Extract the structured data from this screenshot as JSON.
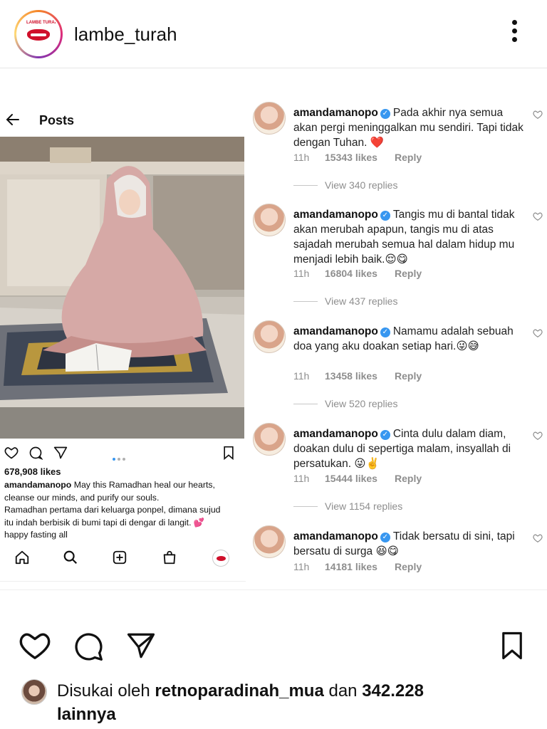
{
  "header": {
    "account": "lambe_turah",
    "logo_text": "LAMBE TURAH"
  },
  "inner_post": {
    "title": "Posts",
    "likes": "678,908 likes",
    "caption_user": "amandamanopo",
    "caption_lines": [
      " May this Ramadhan heal our hearts,",
      "cleanse our minds, and purify our souls.",
      "Ramadhan pertama dari keluarga ponpel, dimana sujud",
      "itu indah berbisik di bumi tapi di dengar di langit. 💕",
      "happy fasting all"
    ]
  },
  "comments": [
    {
      "user": "amandamanopo",
      "text": "Pada akhir nya semua akan pergi meninggalkan mu sendiri. Tapi tidak dengan Tuhan. ❤️",
      "time": "11h",
      "likes": "15343 likes",
      "reply": "Reply",
      "view_replies": "View 340 replies"
    },
    {
      "user": "amandamanopo",
      "text": "Tangis mu di bantal tidak akan merubah apapun, tangis mu di atas sajadah merubah semua hal dalam hidup mu menjadi lebih baik.😌😋",
      "time": "11h",
      "likes": "16804 likes",
      "reply": "Reply",
      "view_replies": "View 437 replies"
    },
    {
      "user": "amandamanopo",
      "text": "Namamu adalah sebuah doa yang aku doakan setiap hari.😜😅",
      "time": "11h",
      "likes": "13458 likes",
      "reply": "Reply",
      "view_replies": "View 520 replies"
    },
    {
      "user": "amandamanopo",
      "text": "Cinta dulu dalam diam, doakan dulu di sepertiga malam, insyallah di persatukan. 😜✌️",
      "time": "11h",
      "likes": "15444 likes",
      "reply": "Reply",
      "view_replies": "View 1154 replies"
    },
    {
      "user": "amandamanopo",
      "text": "Tidak bersatu di sini, tapi bersatu di surga 😆😋",
      "time": "11h",
      "likes": "14181 likes",
      "reply": "Reply",
      "view_replies": ""
    }
  ],
  "liked_by": {
    "prefix": "Disukai oleh ",
    "user": "retnoparadinah_mua",
    "middle": " dan ",
    "count": "342.228",
    "suffix": "lainnya"
  },
  "colors": {
    "accent_blue": "#3897f0",
    "brand_red": "#d0102b",
    "meta_grey": "#8e8e8e"
  },
  "icons": {
    "back": "arrow-left-icon",
    "heart": "heart-icon",
    "comment": "comment-icon",
    "share": "send-icon",
    "bookmark": "bookmark-icon",
    "more": "more-vertical-icon"
  }
}
